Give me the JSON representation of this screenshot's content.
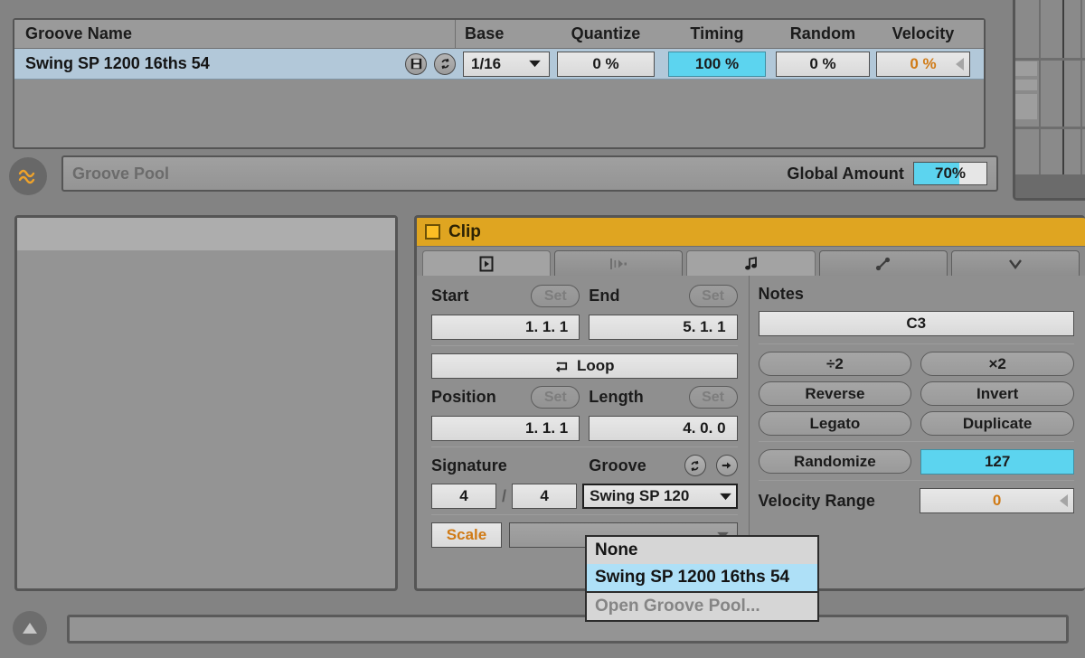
{
  "groove_pool_window": {
    "columns": [
      {
        "key": "name",
        "label": "Groove Name"
      },
      {
        "key": "base",
        "label": "Base"
      },
      {
        "key": "quantize",
        "label": "Quantize"
      },
      {
        "key": "timing",
        "label": "Timing"
      },
      {
        "key": "random",
        "label": "Random"
      },
      {
        "key": "velocity",
        "label": "Velocity"
      }
    ],
    "row": {
      "name": "Swing SP 1200 16ths 54",
      "base": "1/16",
      "quantize": "0 %",
      "timing": "100 %",
      "random": "0 %",
      "velocity": "0 %",
      "save_icon": "floppy-disk-icon",
      "commit_icon": "commit-groove-icon"
    }
  },
  "pool_strip": {
    "wave_icon": "groove-wave-icon",
    "title": "Groove Pool",
    "global_amount_label": "Global Amount",
    "global_amount_value": "70%",
    "global_amount_percent": 62
  },
  "clip": {
    "title": "Clip",
    "checkbox_icon": "clip-activator-icon",
    "tabs": [
      {
        "name": "tab-clip",
        "icon": "play-box-icon",
        "active": true
      },
      {
        "name": "tab-audio",
        "icon": "envelope-fade-icon",
        "active": false
      },
      {
        "name": "tab-notes",
        "icon": "music-note-icon",
        "active": true
      },
      {
        "name": "tab-envelopes",
        "icon": "automation-curve-icon",
        "active": false
      },
      {
        "name": "tab-expression",
        "icon": "velocity-v-icon",
        "active": false
      }
    ],
    "start_label": "Start",
    "start_value": "1.  1.  1",
    "end_label": "End",
    "end_value": "5.  1.  1",
    "set_label": "Set",
    "loop_label": "Loop",
    "loop_icon": "loop-icon",
    "position_label": "Position",
    "position_value": "1.  1.  1",
    "length_label": "Length",
    "length_value": "4.  0.  0",
    "signature_label": "Signature",
    "signature_numerator": "4",
    "signature_denominator": "4",
    "signature_slash": "/",
    "groove_label": "Groove",
    "groove_commit_icon": "commit-groove-icon",
    "groove_extract_icon": "arrow-right-icon",
    "groove_value": "Swing SP 120",
    "groove_caret_icon": "chevron-down-icon",
    "scale_label": "Scale",
    "scale_value": "",
    "scale_caret_icon": "chevron-down-icon"
  },
  "notes": {
    "title": "Notes",
    "root_value": "C3",
    "buttons": [
      {
        "name": "halve-button",
        "label": "÷2"
      },
      {
        "name": "double-button",
        "label": "×2"
      },
      {
        "name": "reverse-button",
        "label": "Reverse"
      },
      {
        "name": "invert-button",
        "label": "Invert"
      },
      {
        "name": "legato-button",
        "label": "Legato"
      },
      {
        "name": "duplicate-button",
        "label": "Duplicate"
      }
    ],
    "randomize_label": "Randomize",
    "randomize_value": "127",
    "velocity_range_label": "Velocity Range",
    "velocity_range_value": "0"
  },
  "groove_dropdown": {
    "open": true,
    "items": [
      {
        "label": "None",
        "selected": false,
        "disabled": false
      },
      {
        "label": "Swing SP 1200 16ths 54",
        "selected": true,
        "disabled": false
      },
      {
        "label": "Open Groove Pool...",
        "selected": false,
        "disabled": true
      }
    ]
  },
  "bottom": {
    "expand_icon": "triangle-up-icon",
    "status_text": ""
  },
  "colors": {
    "accent_cyan": "#5cd4ef",
    "clip_gold": "#dfa521",
    "selection_blue": "#b2c8d9",
    "menu_highlight": "#aee0f7",
    "orange_text": "#d07a15",
    "background_grey": "#838383"
  }
}
